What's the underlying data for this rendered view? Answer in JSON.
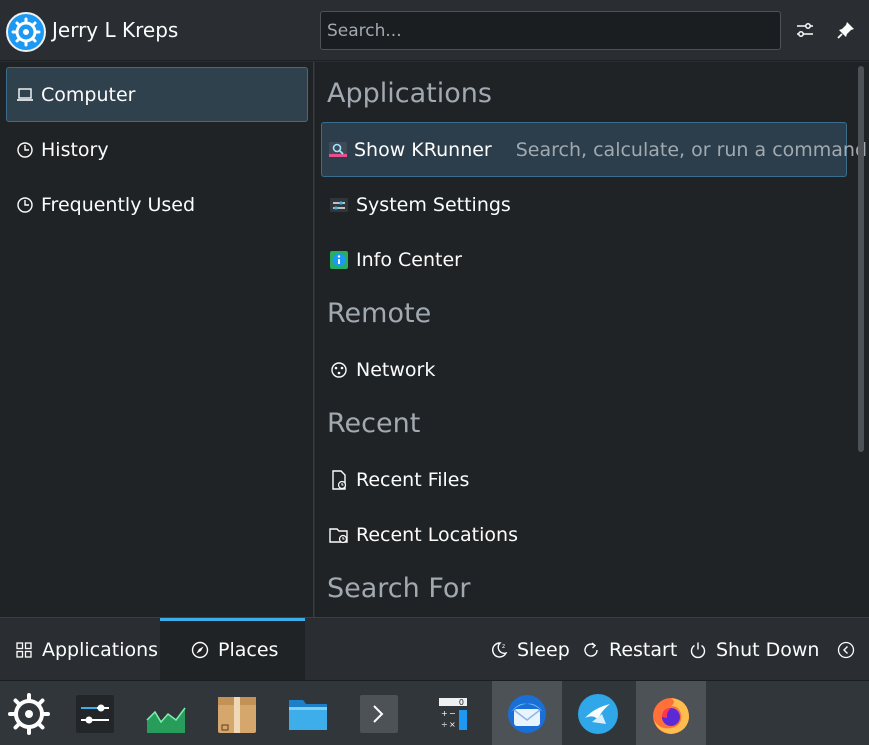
{
  "header": {
    "user_name": "Jerry L Kreps",
    "search_placeholder": "Search..."
  },
  "sidebar": {
    "items": [
      {
        "label": "Computer",
        "icon": "laptop-icon",
        "active": true
      },
      {
        "label": "History",
        "icon": "clock-icon"
      },
      {
        "label": "Frequently Used",
        "icon": "clock-icon"
      }
    ]
  },
  "main": {
    "sections": [
      {
        "title": "Applications"
      },
      {
        "title": "Remote"
      },
      {
        "title": "Recent"
      },
      {
        "title": "Search For"
      }
    ],
    "entries": [
      {
        "label": "Show KRunner",
        "description": "Search, calculate, or run a command",
        "icon": "krunner-icon",
        "highlighted": true
      },
      {
        "label": "System Settings",
        "icon": "system-settings-icon"
      },
      {
        "label": "Info Center",
        "icon": "info-center-icon"
      },
      {
        "label": "Network",
        "icon": "network-icon"
      },
      {
        "label": "Recent Files",
        "icon": "recent-files-icon"
      },
      {
        "label": "Recent Locations",
        "icon": "recent-locations-icon"
      }
    ]
  },
  "footer": {
    "tabs": [
      {
        "label": "Applications",
        "icon": "grid-icon"
      },
      {
        "label": "Places",
        "icon": "compass-icon",
        "active": true
      }
    ],
    "power": [
      {
        "label": "Sleep",
        "icon": "sleep-icon"
      },
      {
        "label": "Restart",
        "icon": "restart-icon"
      },
      {
        "label": "Shut Down",
        "icon": "power-icon"
      }
    ]
  },
  "taskbar": {
    "calculator_display": "0",
    "items": [
      {
        "name": "kde-launcher-icon"
      },
      {
        "name": "system-settings-icon"
      },
      {
        "name": "system-monitor-icon"
      },
      {
        "name": "package-icon"
      },
      {
        "name": "file-manager-icon"
      },
      {
        "name": "terminal-icon"
      },
      {
        "name": "calculator-icon"
      },
      {
        "name": "thunderbird-icon",
        "running": true
      },
      {
        "name": "kdeconnect-icon"
      },
      {
        "name": "firefox-icon",
        "running": true
      }
    ]
  },
  "colors": {
    "accent": "#3daee9",
    "highlight_bg": "#2c3e4b",
    "highlight_border": "#3a6d8c",
    "panel_bg": "#202326",
    "header_bg": "#2a2e32"
  }
}
